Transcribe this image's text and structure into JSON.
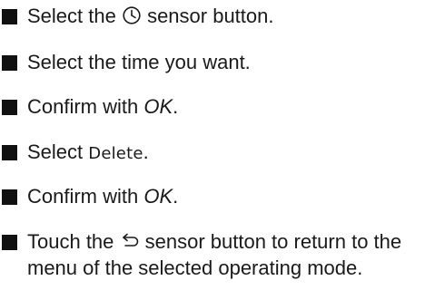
{
  "steps": [
    {
      "before": "Select the ",
      "icon": "timer-icon",
      "after": " sensor button."
    },
    {
      "text": "Select the time you want."
    },
    {
      "before": "Confirm with ",
      "em": "OK",
      "after": "."
    },
    {
      "before": "Select ",
      "ui": "Delete",
      "after": "."
    },
    {
      "before": "Confirm with ",
      "em": "OK",
      "after": "."
    },
    {
      "before": "Touch the ",
      "icon": "back-arrow-icon",
      "after": " sensor button to return to the menu of the selected operating mode."
    }
  ]
}
